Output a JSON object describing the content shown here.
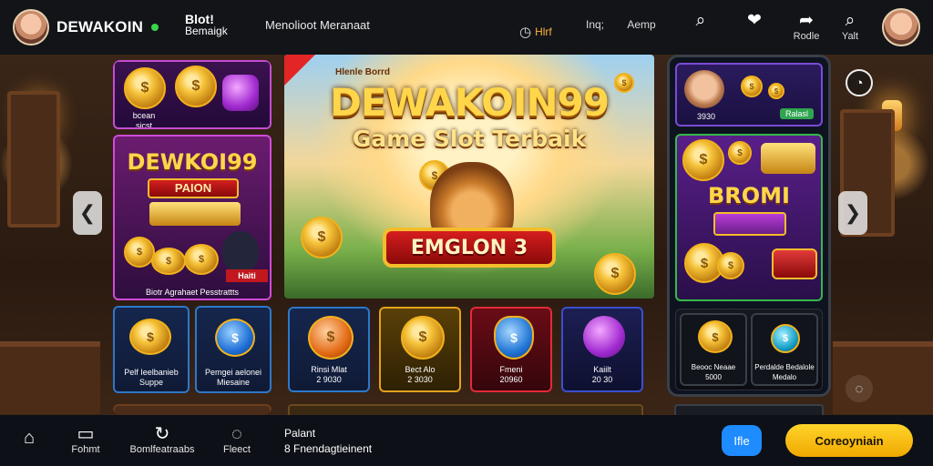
{
  "header": {
    "brand": "DEWAKOIN",
    "sub_title": "Blot!",
    "sub_caption": "Bemaigk",
    "nav_link": "Menolioot Meranaat",
    "actions": [
      {
        "icon": "currency-icon",
        "label": "Hlrf"
      },
      {
        "icon": "info-icon",
        "label": "Inq;"
      },
      {
        "icon": "app-icon",
        "label": "Aemp"
      },
      {
        "icon": "search-icon",
        "label": ""
      },
      {
        "icon": "heart-icon",
        "label": ""
      },
      {
        "icon": "share-icon",
        "label": "Rodle"
      },
      {
        "icon": "search-icon",
        "label": "Yalt"
      }
    ]
  },
  "left_column": {
    "top_card_label_1": "bcean",
    "top_card_label_2": "sicst",
    "promo_title": "DEWKOI99",
    "promo_badge": "PAION",
    "promo_footer": "Biotr Agrahaet Pesstrattts",
    "bear_tag": "Haiti",
    "cards": [
      {
        "line1": "Pelf Ieelbanieb",
        "line2": "Suppe"
      },
      {
        "line1": "Pemgei aelonei",
        "line2": "Miesaine"
      }
    ]
  },
  "banner": {
    "tag": "Hlenle Borrd",
    "title": "DEWAKOIN99",
    "subtitle": "Game Slot Terbaik",
    "emblem": "EMGLON 3"
  },
  "mid_cards": [
    {
      "line1": "Rinsi Mlat",
      "line2": "2 9030"
    },
    {
      "line1": "Bect Alo",
      "line2": "2 3030"
    },
    {
      "line1": "Fmeni",
      "line2": "20960"
    },
    {
      "line1": "Kaiilt",
      "line2": "20 30"
    }
  ],
  "phone": {
    "tag_1": "3930",
    "tag_2": "Ralasl",
    "bonus": "BROMI",
    "cards": [
      {
        "line1": "Beooc Neaae",
        "line2": "5000"
      },
      {
        "line1": "Perdalde Bedalole",
        "line2": "Medalo"
      }
    ]
  },
  "bottom": {
    "nav": [
      {
        "icon": "home-icon",
        "label": ""
      },
      {
        "icon": "folder-icon",
        "label": "Fohmt"
      },
      {
        "icon": "refresh-icon",
        "label": "Bomlfeatraabs"
      },
      {
        "icon": "chat-icon",
        "label": "Fleect"
      }
    ],
    "text_1": "Palant",
    "text_2": "8 Fnendagtieinent",
    "btn_blue": "Ifle",
    "btn_yellow": "Coreoyniain"
  },
  "colors": {
    "accent_gold": "#f4bd2b",
    "accent_blue": "#1e8bff",
    "card_border": "#2d78c9",
    "button_yellow": "#ffd42a"
  }
}
